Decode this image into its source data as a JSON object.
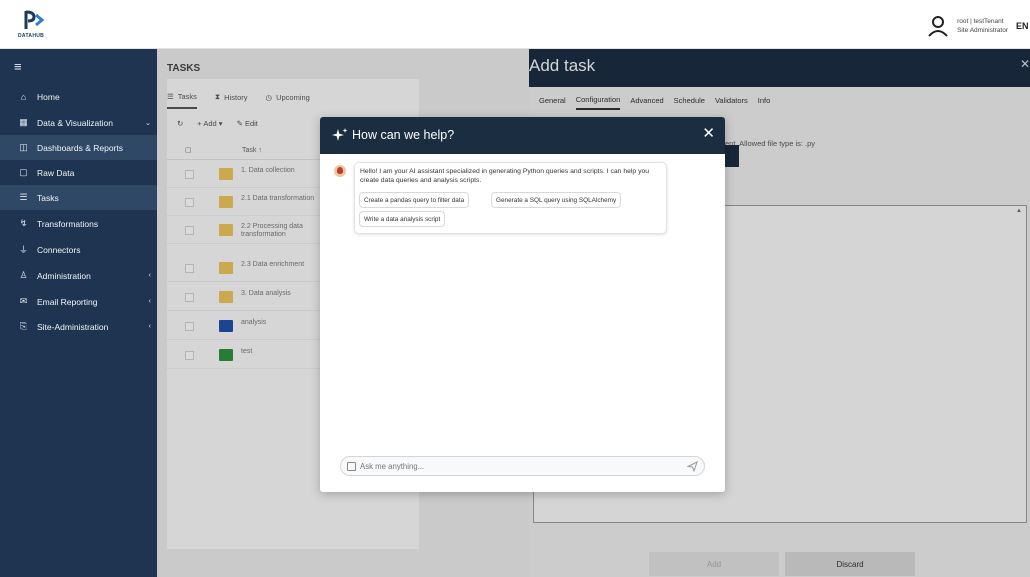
{
  "brand": {
    "logo_text": "DATAHUB"
  },
  "user": {
    "name": "root | testTenant",
    "role": "Site Administrator",
    "lang": "EN"
  },
  "sidebar": {
    "items": [
      {
        "label": "Home",
        "icon": "home-icon",
        "has_chevron": false
      },
      {
        "label": "Data & Visualization",
        "icon": "calendar-icon",
        "has_chevron": true
      },
      {
        "label": "Dashboards & Reports",
        "icon": "dashboard-icon",
        "has_chevron": false
      },
      {
        "label": "Raw Data",
        "icon": "file-icon",
        "has_chevron": false
      },
      {
        "label": "Tasks",
        "icon": "list-icon",
        "has_chevron": false
      },
      {
        "label": "Transformations",
        "icon": "transform-icon",
        "has_chevron": false
      },
      {
        "label": "Connectors",
        "icon": "connector-icon",
        "has_chevron": false
      },
      {
        "label": "Administration",
        "icon": "users-icon",
        "has_chevron": true
      },
      {
        "label": "Email Reporting",
        "icon": "email-icon",
        "has_chevron": true
      },
      {
        "label": "Site-Administration",
        "icon": "site-admin-icon",
        "has_chevron": true
      }
    ]
  },
  "tasks": {
    "title": "TASKS",
    "tabs": [
      "Tasks",
      "History",
      "Upcoming"
    ],
    "toolbar": {
      "add": "Add ▾",
      "edit": "Edit"
    },
    "column_name": "Task ↑",
    "rows": [
      {
        "label": "1. Data collection",
        "type": "folder"
      },
      {
        "label": "2.1 Data transformation",
        "type": "folder"
      },
      {
        "label": "2.2 Processing data transformation",
        "type": "folder"
      },
      {
        "label": "2.3 Data enrichment",
        "type": "folder"
      },
      {
        "label": "3. Data analysis",
        "type": "folder"
      },
      {
        "label": "analysis",
        "type": "blue"
      },
      {
        "label": "test",
        "type": "green"
      }
    ]
  },
  "add_task": {
    "title": "Add task",
    "tabs": [
      "General",
      "Configuration",
      "Advanced",
      "Schedule",
      "Validators",
      "Info"
    ],
    "hint": "ent. Allowed file type is: .py",
    "add_label": "Add",
    "discard_label": "Discard"
  },
  "chat": {
    "title": "How can we help?",
    "close": "✕",
    "message": "Hello! I am your AI assistant specialized in generating Python queries and scripts. I can help you create data queries and analysis scripts.",
    "suggestions": [
      "Create a pandas query to filter data",
      "Generate a SQL query using SQLAlchemy",
      "Write a data analysis script"
    ],
    "placeholder": "Ask me anything..."
  },
  "colors": {
    "navy": "#1b2d41",
    "sidebar": "#1e3450",
    "folder": "#e9c05a"
  }
}
